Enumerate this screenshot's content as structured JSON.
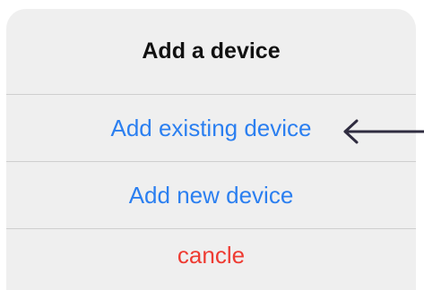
{
  "action_sheet": {
    "title": "Add a device",
    "actions": [
      {
        "label": "Add existing device"
      },
      {
        "label": "Add new device"
      },
      {
        "label": "cancle"
      }
    ]
  },
  "annotation": {
    "icon": "left-arrow-icon",
    "color": "#2f2c40"
  },
  "colors": {
    "action_blue": "#2b7ff0",
    "cancel_red": "#ee3b32",
    "sheet_background": "#efefef",
    "divider": "#cfcfcf"
  }
}
